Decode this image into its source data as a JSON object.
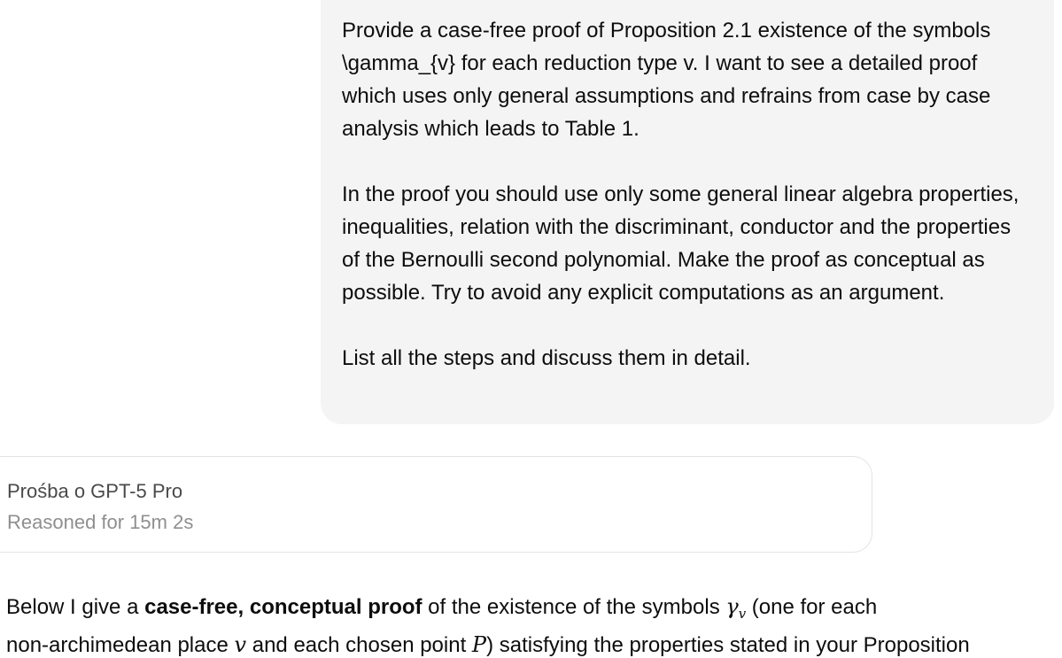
{
  "conversation": {
    "user_message": {
      "paragraphs": [
        "Provide a case-free proof of Proposition 2.1 existence of the symbols \\gamma_{v} for each reduction type v. I want to see a detailed proof which uses only general assumptions and refrains from case by case analysis which leads to Table 1.",
        "In the proof you should use only some general linear algebra properties, inequalities, relation with the discriminant, conductor and the properties of the Bernoulli second polynomial. Make the proof as conceptual as possible. Try to avoid any explicit computations as an argument.",
        "List all the steps and discuss them in detail."
      ]
    },
    "reasoning": {
      "title": "Prośba o GPT-5 Pro",
      "subtitle": "Reasoned for 15m 2s"
    },
    "assistant_message": {
      "line1_prefix": "Below I give a ",
      "line1_bold": "case-free, conceptual proof",
      "line1_mid": " of the existence of the symbols ",
      "gamma_symbol": "γ",
      "gamma_subscript": "v",
      "line1_suffix": " (one for each",
      "line2_prefix": "non-archimedean place ",
      "place_symbol": "v",
      "line2_mid": " and each chosen point ",
      "point_symbol": "P",
      "line2_suffix": ") satisfying the properties stated in your Proposition"
    }
  }
}
